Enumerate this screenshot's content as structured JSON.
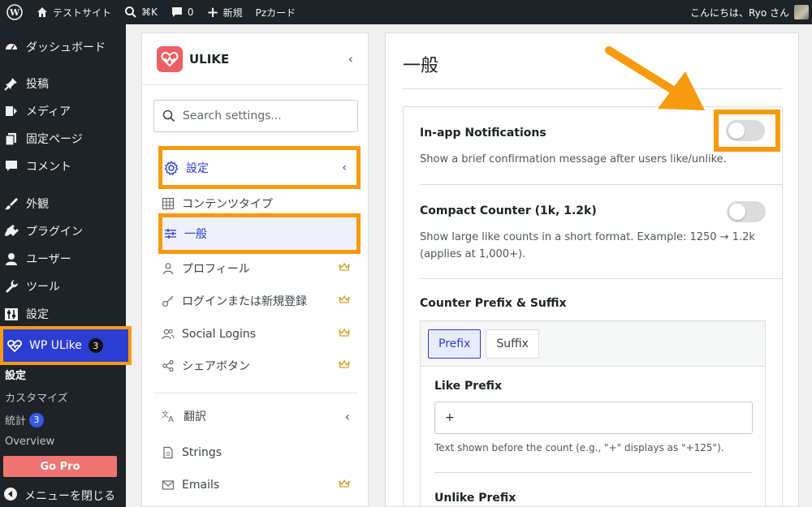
{
  "adminbar": {
    "site_name": "テストサイト",
    "shortcut": "⌘K",
    "comments_count": "0",
    "new_label": "新規",
    "pz_label": "Pzカード",
    "greeting": "こんにちは、Ryo さん"
  },
  "menu": {
    "items": [
      {
        "label": "ダッシュボード",
        "icon": "dashboard-icon"
      },
      {
        "label": "投稿",
        "icon": "pin-icon"
      },
      {
        "label": "メディア",
        "icon": "media-icon"
      },
      {
        "label": "固定ページ",
        "icon": "pages-icon"
      },
      {
        "label": "コメント",
        "icon": "comment-icon"
      },
      {
        "label": "外観",
        "icon": "brush-icon"
      },
      {
        "label": "プラグイン",
        "icon": "plugin-icon"
      },
      {
        "label": "ユーザー",
        "icon": "user-icon"
      },
      {
        "label": "ツール",
        "icon": "wrench-icon"
      },
      {
        "label": "設定",
        "icon": "settings-icon"
      }
    ],
    "active": {
      "label": "WP ULike",
      "badge": "3"
    },
    "submenu": {
      "settings": "設定",
      "customize": "カスタマイズ",
      "stats": "統計",
      "stats_badge": "3",
      "overview": "Overview"
    },
    "go_pro": "Go Pro",
    "collapse": "メニューを閉じる"
  },
  "sidebar": {
    "brand": "ULIKE",
    "search_placeholder": "Search settings...",
    "group_settings": "設定",
    "items": {
      "content_types": "コンテンツタイプ",
      "general": "一般",
      "profile": "プロフィール",
      "login": "ログインまたは新規登録",
      "social_logins": "Social Logins",
      "share_buttons": "シェアボタン"
    },
    "group_translation": "翻訳",
    "strings": "Strings",
    "emails": "Emails"
  },
  "main": {
    "title": "一般",
    "inapp": {
      "title": "In-app Notifications",
      "desc": "Show a brief confirmation message after users like/unlike.",
      "enabled": false
    },
    "compact": {
      "title": "Compact Counter (1k, 1.2k)",
      "desc1": "Show large like counts in a short format. Example: 1250 → 1.2k",
      "desc2": "(applies at 1,000+).",
      "enabled": false
    },
    "prefix_suffix": {
      "title": "Counter Prefix & Suffix",
      "tab_prefix": "Prefix",
      "tab_suffix": "Suffix",
      "like_prefix_label": "Like Prefix",
      "like_prefix_value": "+",
      "like_prefix_desc": "Text shown before the count (e.g., \"+\" displays as \"+125\").",
      "unlike_prefix_label": "Unlike Prefix"
    }
  },
  "colors": {
    "highlight": "#f79a0e",
    "accent": "#2c3ed1",
    "brand": "#ec6065"
  }
}
